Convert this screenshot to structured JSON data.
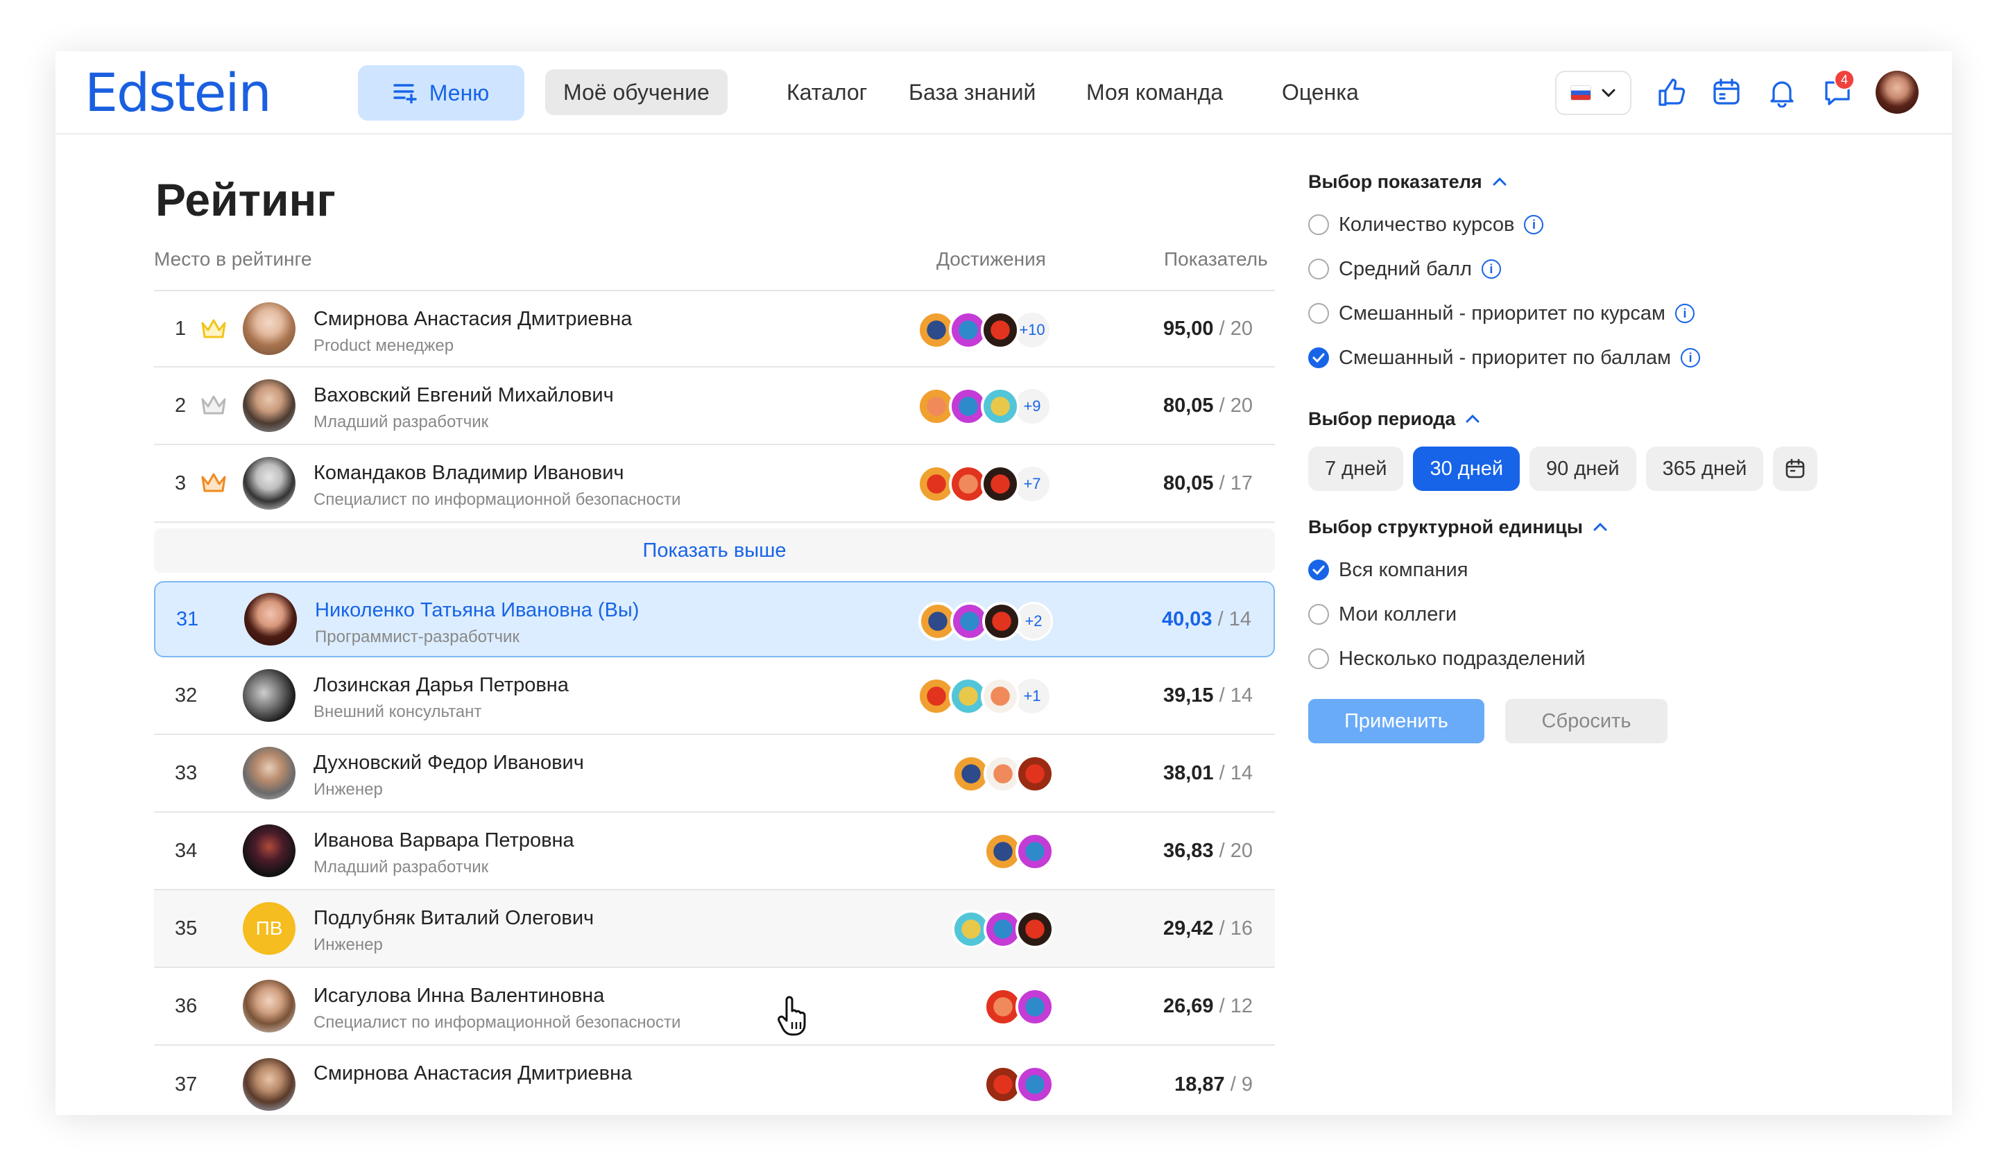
{
  "header": {
    "logo": "Edstein",
    "menu_label": "Меню",
    "nav": [
      "Моё обучение",
      "Каталог",
      "База знаний",
      "Моя команда",
      "Оценка"
    ],
    "active_nav": "Моё обучение",
    "notification_count": "4",
    "language": "ru"
  },
  "page": {
    "title": "Рейтинг",
    "col_place": "Место в рейтинге",
    "col_achievements": "Достижения",
    "col_score": "Показатель",
    "show_more": "Показать выше"
  },
  "rows": [
    {
      "rank": "1",
      "name": "Смирнова Анастасия Дмитриевна",
      "role": "Product менеджер",
      "score": "95,00",
      "max": " / 20",
      "more": "+10",
      "crown": "gold"
    },
    {
      "rank": "2",
      "name": "Ваховский Евгений Михайлович",
      "role": "Младший разработчик",
      "score": "80,05",
      "max": " / 20",
      "more": "+9",
      "crown": "silver"
    },
    {
      "rank": "3",
      "name": "Командаков Владимир Иванович",
      "role": "Специалист по информационной безопасности",
      "score": "80,05",
      "max": " / 17",
      "more": "+7",
      "crown": "bronze"
    },
    {
      "rank": "31",
      "name": "Николенко Татьяна Ивановна (Вы)",
      "role": "Программист-разработчик",
      "score": "40,03",
      "max": " / 14",
      "more": "+2",
      "me": true
    },
    {
      "rank": "32",
      "name": "Лозинская Дарья Петровна",
      "role": "Внешний консультант",
      "score": "39,15",
      "max": " / 14",
      "more": "+1"
    },
    {
      "rank": "33",
      "name": "Духновский Федор Иванович",
      "role": "Инженер",
      "score": "38,01",
      "max": " / 14",
      "more": ""
    },
    {
      "rank": "34",
      "name": "Иванова Варвара Петровна",
      "role": "Младший разработчик",
      "score": "36,83",
      "max": " / 20",
      "more": ""
    },
    {
      "rank": "35",
      "name": "Подлубняк Виталий Олегович",
      "role": "Инженер",
      "score": "29,42",
      "max": " / 16",
      "more": "",
      "initials": "ПВ"
    },
    {
      "rank": "36",
      "name": "Исагулова Инна Валентиновна",
      "role": "Специалист по информационной безопасности",
      "score": "26,69",
      "max": " / 12",
      "more": ""
    },
    {
      "rank": "37",
      "name": "Смирнова Анастасия Дмитриевна",
      "role": "",
      "score": "18,87",
      "max": " / 9",
      "more": ""
    }
  ],
  "filters": {
    "metric_title": "Выбор показателя",
    "metrics": [
      "Количество курсов",
      "Средний балл",
      "Смешанный - приоритет по курсам",
      "Смешанный - приоритет по баллам"
    ],
    "metric_selected": "Смешанный - приоритет по баллам",
    "period_title": "Выбор периода",
    "periods": [
      "7 дней",
      "30 дней",
      "90 дней",
      "365 дней"
    ],
    "period_selected": "30 дней",
    "unit_title": "Выбор структурной единицы",
    "units": [
      "Вся компания",
      "Мои коллеги",
      "Несколько подразделений"
    ],
    "unit_selected": "Вся компания",
    "apply": "Применить",
    "reset": "Сбросить"
  },
  "colors": {
    "accent": "#1764e8",
    "accent_light": "#dcedff",
    "gold": "#f2c41b",
    "bronze": "#f08a1e"
  }
}
